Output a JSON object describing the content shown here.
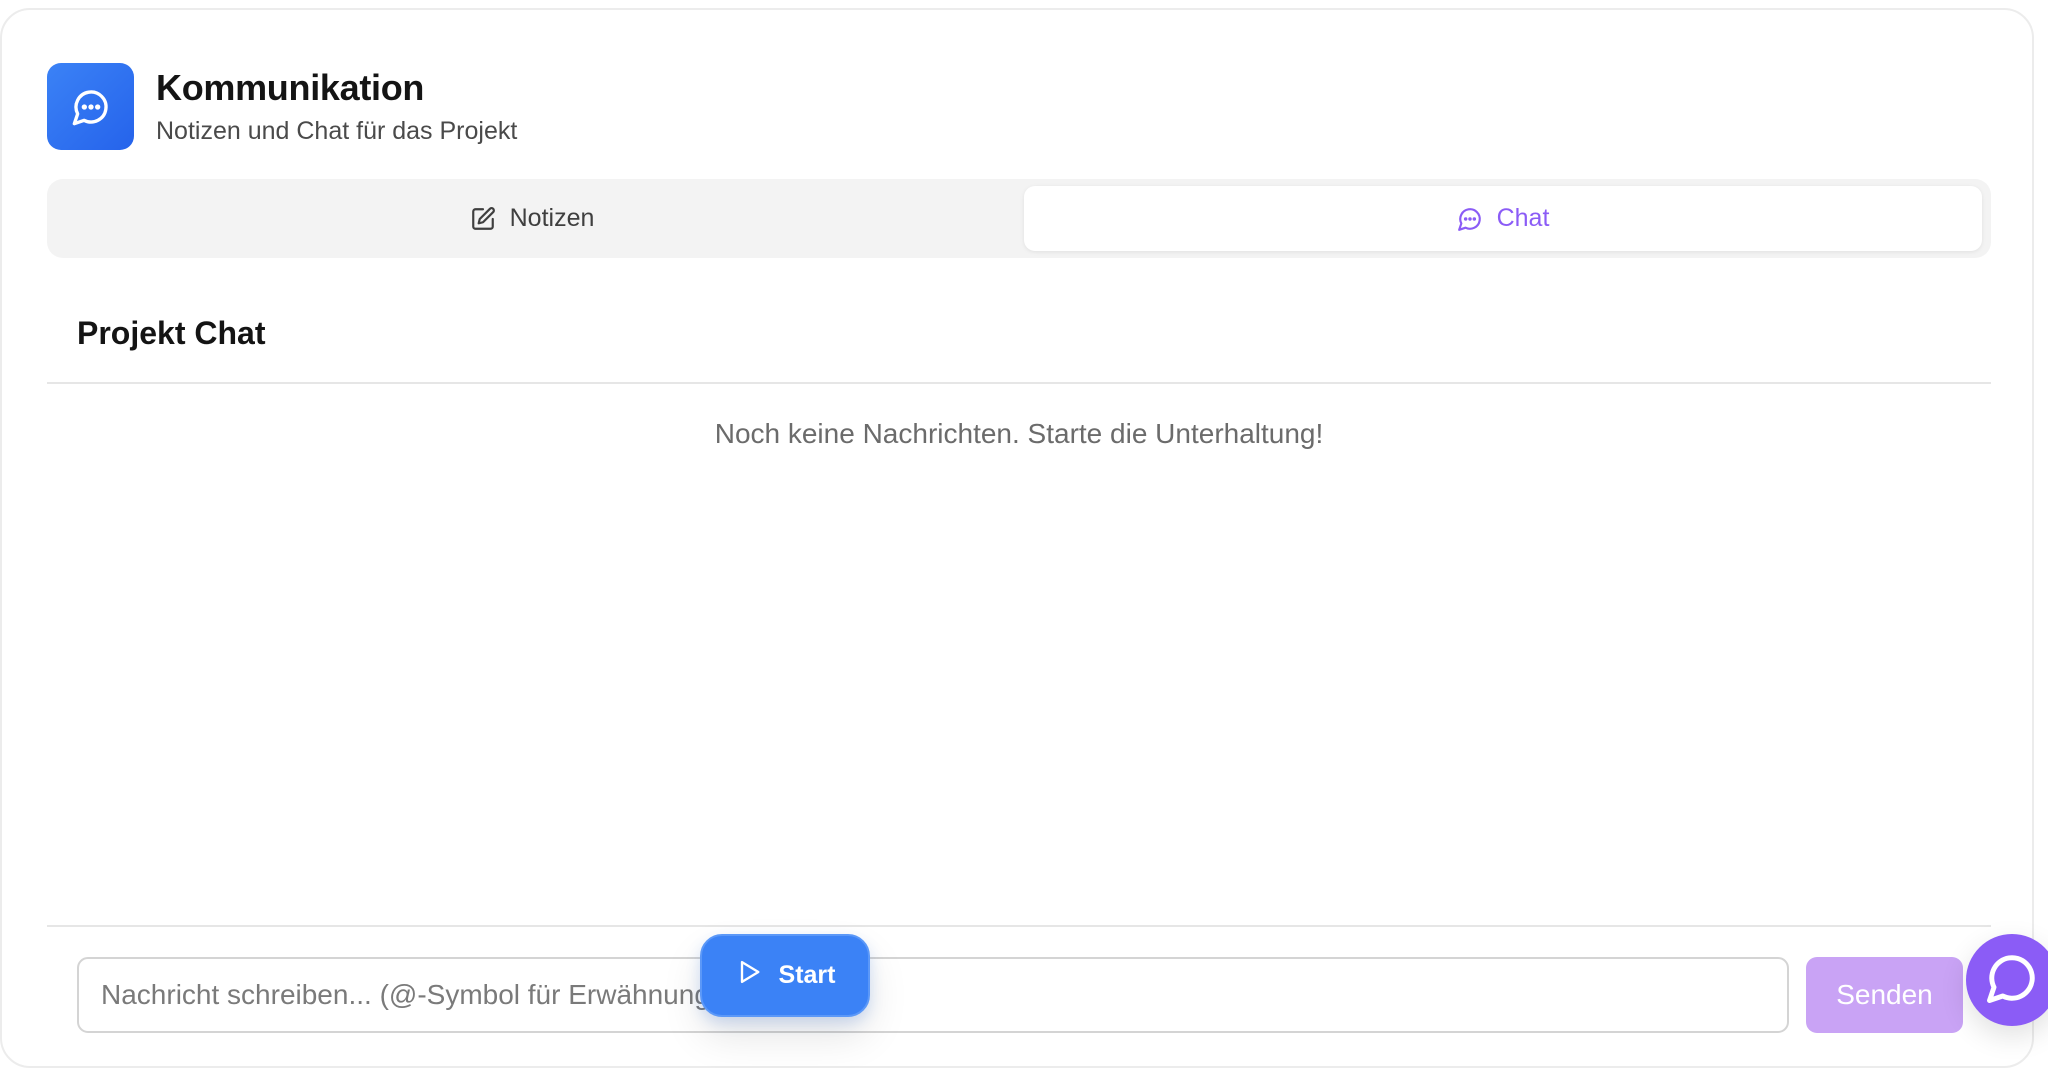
{
  "header": {
    "icon": "chat-bubble-icon",
    "title": "Kommunikation",
    "subtitle": "Notizen und Chat für das Projekt"
  },
  "tabs": [
    {
      "label": "Notizen",
      "icon": "edit-icon",
      "active": false
    },
    {
      "label": "Chat",
      "icon": "chat-bubble-icon",
      "active": true
    }
  ],
  "chat": {
    "title": "Projekt Chat",
    "empty_message": "Noch keine Nachrichten. Starte die Unterhaltung!",
    "input_placeholder": "Nachricht schreiben... (@-Symbol für Erwähnungen)",
    "send_label": "Senden"
  },
  "floating": {
    "start_label": "Start",
    "start_icon": "play-icon",
    "widget_icon": "chat-widget-icon"
  },
  "colors": {
    "primary_blue": "#3b82f6",
    "accent_purple": "#8b5cf6",
    "send_disabled": "#c9a3f5"
  }
}
